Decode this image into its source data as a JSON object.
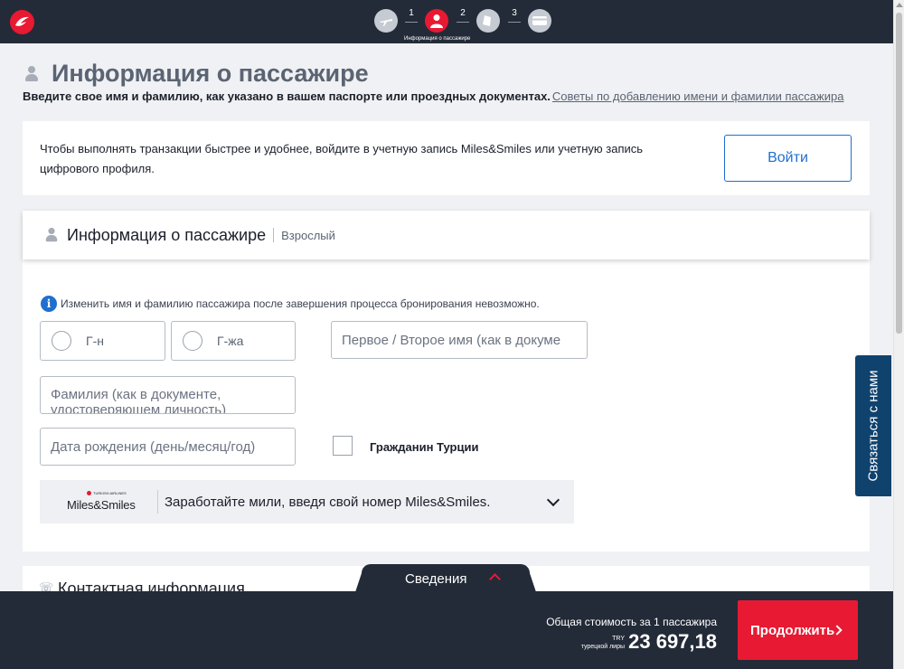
{
  "header": {
    "steps": [
      {
        "icon": "plane-icon",
        "num": "1"
      },
      {
        "icon": "passenger-icon",
        "num": "2",
        "caption": "Информация о пассажире"
      },
      {
        "icon": "seat-icon",
        "num": "3"
      },
      {
        "icon": "payment-card-icon"
      }
    ],
    "accent": "#e81932",
    "bg": "#232b38"
  },
  "page": {
    "title": "Информация о пассажире",
    "subtitle": "Введите свое имя и фамилию, как указано в вашем паспорте или проездных документах.",
    "subtitle_link": "Советы по добавлению имени и фамилии пассажира"
  },
  "login": {
    "text": "Чтобы выполнять транзакции быстрее и удобнее, войдите в учетную запись Miles&Smiles или учетную запись цифрового профиля.",
    "button": "Войти"
  },
  "passenger": {
    "title": "Информация о пассажире",
    "type": "Взрослый",
    "notice": "Изменить имя и фамилию пассажира после завершения процесса бронирования невозможно.",
    "title_options": [
      "Г-н",
      "Г-жа"
    ],
    "first_name_placeholder": "Первое / Второе имя (как в документе, удостоверяющем личность)",
    "first_name_visible": "Первое / Второе имя (как в докуме",
    "last_name_placeholder": "Фамилия (как в документе, удостоверяющем личность)",
    "birth_date_placeholder": "Дата рождения (день/месяц/год)",
    "citizen_label": "Гражданин Турции",
    "miles": {
      "brand_small": "TURKISH AIRLINES",
      "brand": "Miles&Smiles",
      "text": "Заработайте мили, введя свой номер Miles&Smiles."
    }
  },
  "contact": {
    "title": "Контактная информация",
    "side_tab": "Связаться с нами"
  },
  "footer": {
    "details_tab": "Сведения",
    "total_label": "Общая стоимость за 1 пассажира",
    "currency_code": "TRY",
    "currency_name": "турецкой лиры",
    "price": "23 697,18",
    "continue": "Продолжить"
  }
}
